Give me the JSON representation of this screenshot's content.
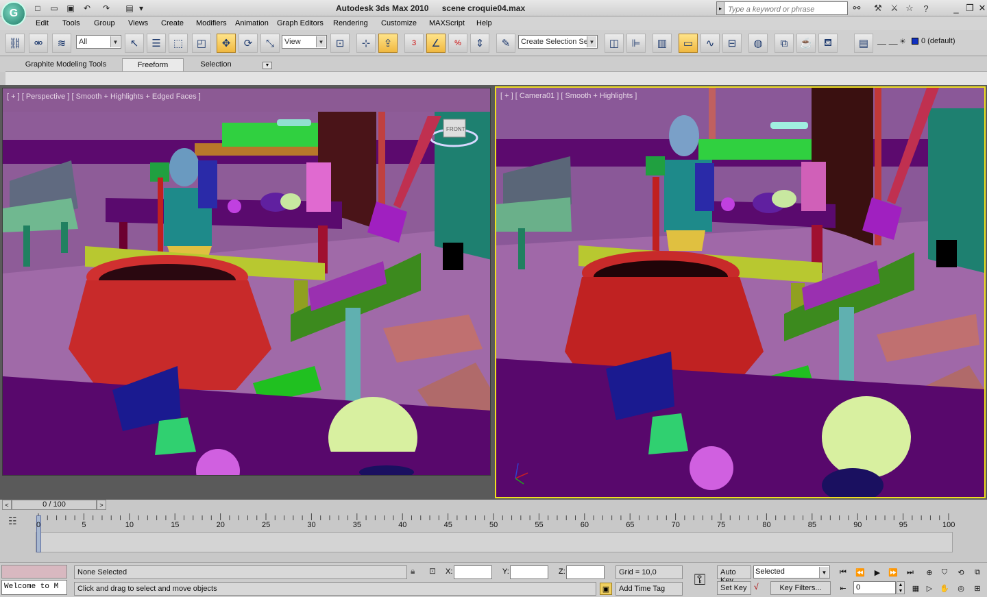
{
  "window": {
    "app_title": "Autodesk 3ds Max  2010",
    "scene_name": "scene croquie04.max",
    "search_placeholder": "Type a keyword or phrase"
  },
  "menu": [
    "Edit",
    "Tools",
    "Group",
    "Views",
    "Create",
    "Modifiers",
    "Animation",
    "Graph Editors",
    "Rendering",
    "Customize",
    "MAXScript",
    "Help"
  ],
  "toolbar": {
    "filter_value": "All",
    "coord_value": "View",
    "selection_set_value": "Create Selection Se",
    "layer_value": "0 (default)",
    "snap_number": "3",
    "snap_percent": "%"
  },
  "ribbon": {
    "tabs": [
      "Graphite Modeling Tools",
      "Freeform",
      "Selection"
    ]
  },
  "viewports": {
    "left_label": "[ + ] [ Perspective ] [ Smooth + Highlights + Edged Faces ]",
    "right_label": "[ + ] [ Camera01 ] [ Smooth + Highlights ]",
    "viewcube_label": "FRONT"
  },
  "timeline": {
    "frame_field": "0 / 100",
    "ticks": [
      "0",
      "5",
      "10",
      "15",
      "20",
      "25",
      "30",
      "35",
      "40",
      "45",
      "50",
      "55",
      "60",
      "65",
      "70",
      "75",
      "80",
      "85",
      "90",
      "95",
      "100"
    ]
  },
  "status": {
    "listener_text": "Welcome to M",
    "selection_text": "None Selected",
    "prompt_text": "Click and drag to select and move objects",
    "x_label": "X:",
    "y_label": "Y:",
    "z_label": "Z:",
    "grid_text": "Grid = 10,0",
    "add_time_tag": "Add Time Tag",
    "auto_key": "Auto Key",
    "set_key": "Set Key",
    "key_mode_value": "Selected",
    "key_filters": "Key Filters...",
    "current_frame": "0"
  },
  "colors": {
    "viewport_bg": "#8c5a94",
    "active_viewport_border": "#f0e020",
    "pot_red": "#c02828",
    "table_purple": "#5a0a6e"
  }
}
